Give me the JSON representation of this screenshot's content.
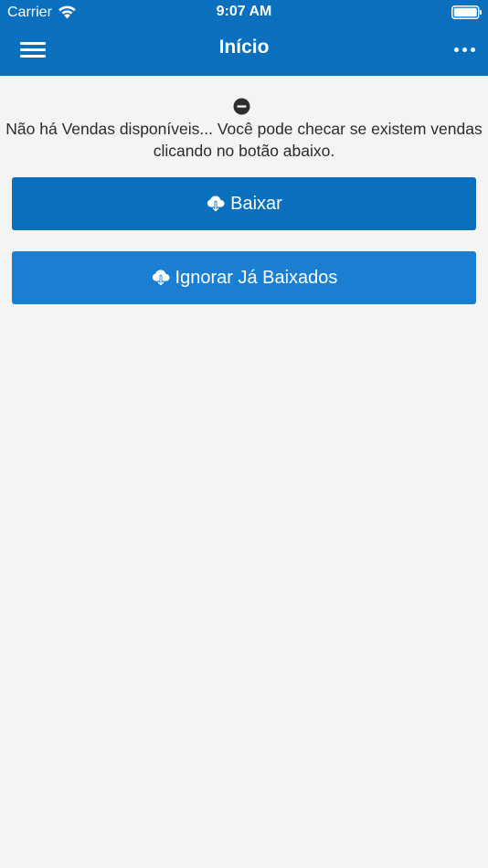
{
  "status_bar": {
    "carrier": "Carrier",
    "time": "9:07 AM",
    "wifi_icon": "wifi-icon",
    "battery_icon": "battery-icon"
  },
  "nav": {
    "title": "Início",
    "menu_icon": "hamburger-menu-icon",
    "more_icon": "more-dots-icon"
  },
  "main": {
    "empty_icon": "minus-circle-icon",
    "message": "Não há Vendas disponíveis... Você pode checar se existem vendas clicando no botão abaixo.",
    "buttons": [
      {
        "label": "Baixar",
        "icon": "cloud-download-icon"
      },
      {
        "label": "Ignorar Já Baixados",
        "icon": "cloud-download-icon"
      }
    ]
  },
  "colors": {
    "header": "#0a6fbd",
    "primary_button": "#0a6fbd",
    "secondary_button": "#1a7fd0",
    "background": "#f4f4f4",
    "text": "#2b2b2b"
  }
}
